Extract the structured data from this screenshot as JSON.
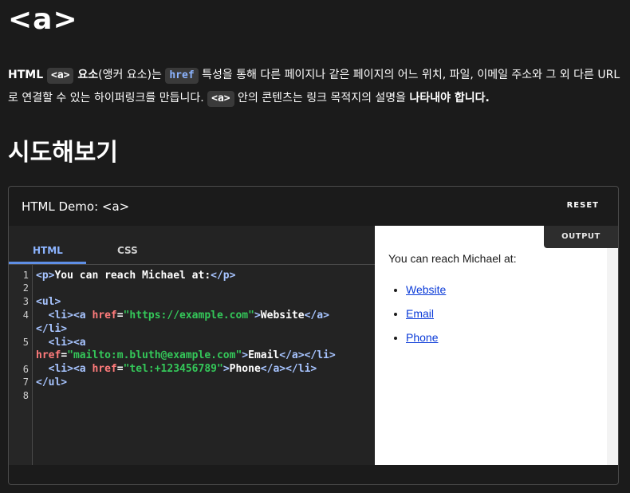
{
  "page": {
    "title": "<a>"
  },
  "intro": {
    "p1": "HTML ",
    "chip1": "<a>",
    "p2_bold": " 요소",
    "p3": "(앵커 요소)는 ",
    "chip2": "href",
    "p4": " 특성을 통해 다른 페이지나 같은 페이지의 어느 위치, 파일, 이메일 주소와 그 외 다른 URL로 연결할 수 있는 하이퍼링크를 만듭니다. ",
    "chip3": "<a>",
    "p5": " 안의 콘텐츠는 링크 목적지의 설명을 ",
    "p6_bold": "나타내야 합니다."
  },
  "section": {
    "title": "시도해보기"
  },
  "demo": {
    "title": "HTML Demo: <a>",
    "reset": "RESET",
    "tabs": {
      "html": "HTML",
      "css": "CSS"
    },
    "line_numbers": [
      "1",
      "2",
      "3",
      "4",
      "5",
      "6",
      "7",
      "8"
    ],
    "code": {
      "l1_p_open": "<p>",
      "l1_text": "You can reach Michael at:",
      "l1_p_close": "</p>",
      "ul_open": "<ul>",
      "li_open": "<li>",
      "a_open_tag": "<a",
      "href_attr": "href",
      "eq": "=",
      "href_web": "\"https://example.com\"",
      "gt": ">",
      "website_text": "Website",
      "a_close": "</a>",
      "li_close": "</li>",
      "href_mail": "\"mailto:m.bluth@example.com\"",
      "email_text": "Email",
      "href_tel": "\"tel:+123456789\"",
      "phone_text": "Phone",
      "ul_close": "</ul>"
    },
    "output": {
      "label": "OUTPUT",
      "text": "You can reach Michael at:",
      "links": [
        "Website",
        "Email",
        "Phone"
      ]
    }
  }
}
